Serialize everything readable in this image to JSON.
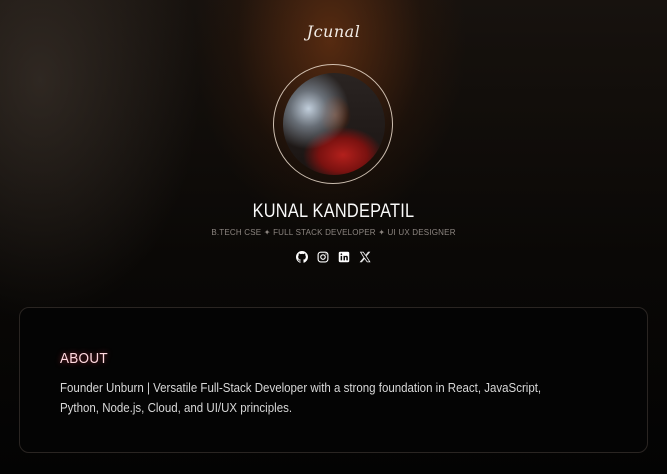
{
  "header": {
    "logo_text": "Jcunal"
  },
  "profile": {
    "name": "KUNAL KANDEPATIL",
    "tagline": "B.TECH CSE ✦ FULL STACK DEVELOPER ✦ UI UX DESIGNER",
    "socials": [
      {
        "icon": "github-icon"
      },
      {
        "icon": "instagram-icon"
      },
      {
        "icon": "linkedin-icon"
      },
      {
        "icon": "x-icon"
      }
    ]
  },
  "about": {
    "title": "ABOUT",
    "text": "Founder Unburn | Versatile Full-Stack Developer with a strong foundation in React, JavaScript, Python, Node.js, Cloud, and UI/UX principles."
  },
  "colors": {
    "accent_title": "#ffd9df",
    "glow": "#8c4014",
    "background": "#050403"
  }
}
